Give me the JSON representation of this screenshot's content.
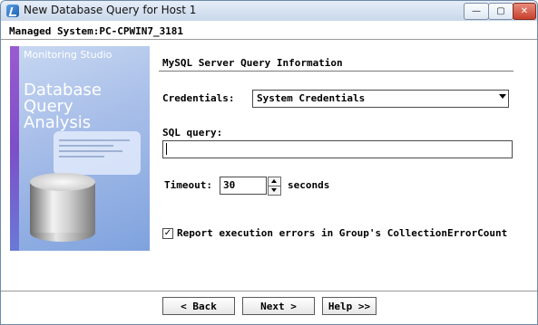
{
  "window": {
    "title": "New Database Query for Host 1"
  },
  "header": {
    "managed_system": "Managed System:PC-CPWIN7_3181"
  },
  "banner": {
    "brand": "Monitoring Studio",
    "headline_line1": "Database Query",
    "headline_line2": "Analysis"
  },
  "form": {
    "section_title": "MySQL Server Query Information",
    "credentials_label": "Credentials:",
    "credentials_value": "System Credentials",
    "sql_label": "SQL query:",
    "sql_value": "",
    "timeout_label": "Timeout:",
    "timeout_value": "30",
    "timeout_unit": "seconds",
    "report_errors_checked": true,
    "report_errors_label": "Report execution errors in Group's CollectionErrorCount"
  },
  "footer": {
    "back_label": "< Back",
    "next_label": "Next >",
    "help_label": "Help >>"
  },
  "icons": {
    "app": "app-icon",
    "minimize": "minimize-icon",
    "maximize": "maximize-icon",
    "close": "close-icon",
    "dropdown": "chevron-down-icon",
    "spin_up": "spin-up-icon",
    "spin_down": "spin-down-icon",
    "check": "checkmark-icon"
  }
}
